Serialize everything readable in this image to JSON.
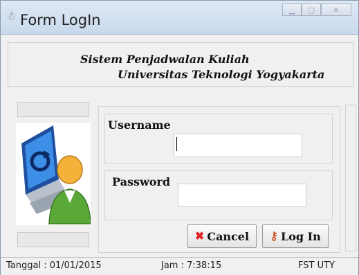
{
  "window": {
    "title": "Form LogIn",
    "icon": "application-icon"
  },
  "header": {
    "line1": "Sistem Penjadwalan Kuliah",
    "line2": "Universitas Teknologi Yogyakarta"
  },
  "form": {
    "username_label": "Username",
    "username_value": "",
    "password_label": "Password",
    "password_value": ""
  },
  "buttons": {
    "cancel_label": "Cancel",
    "cancel_icon": "x-icon",
    "login_label": "Log In",
    "login_icon": "key-icon"
  },
  "status": {
    "date": "Tanggal : 01/01/2015",
    "time": "Jam : 7:38:15",
    "org": "FST UTY"
  },
  "colors": {
    "cancel_icon": "#e0262b",
    "monitor_blue": "#2a6fc6",
    "user_green": "#5aa838"
  }
}
